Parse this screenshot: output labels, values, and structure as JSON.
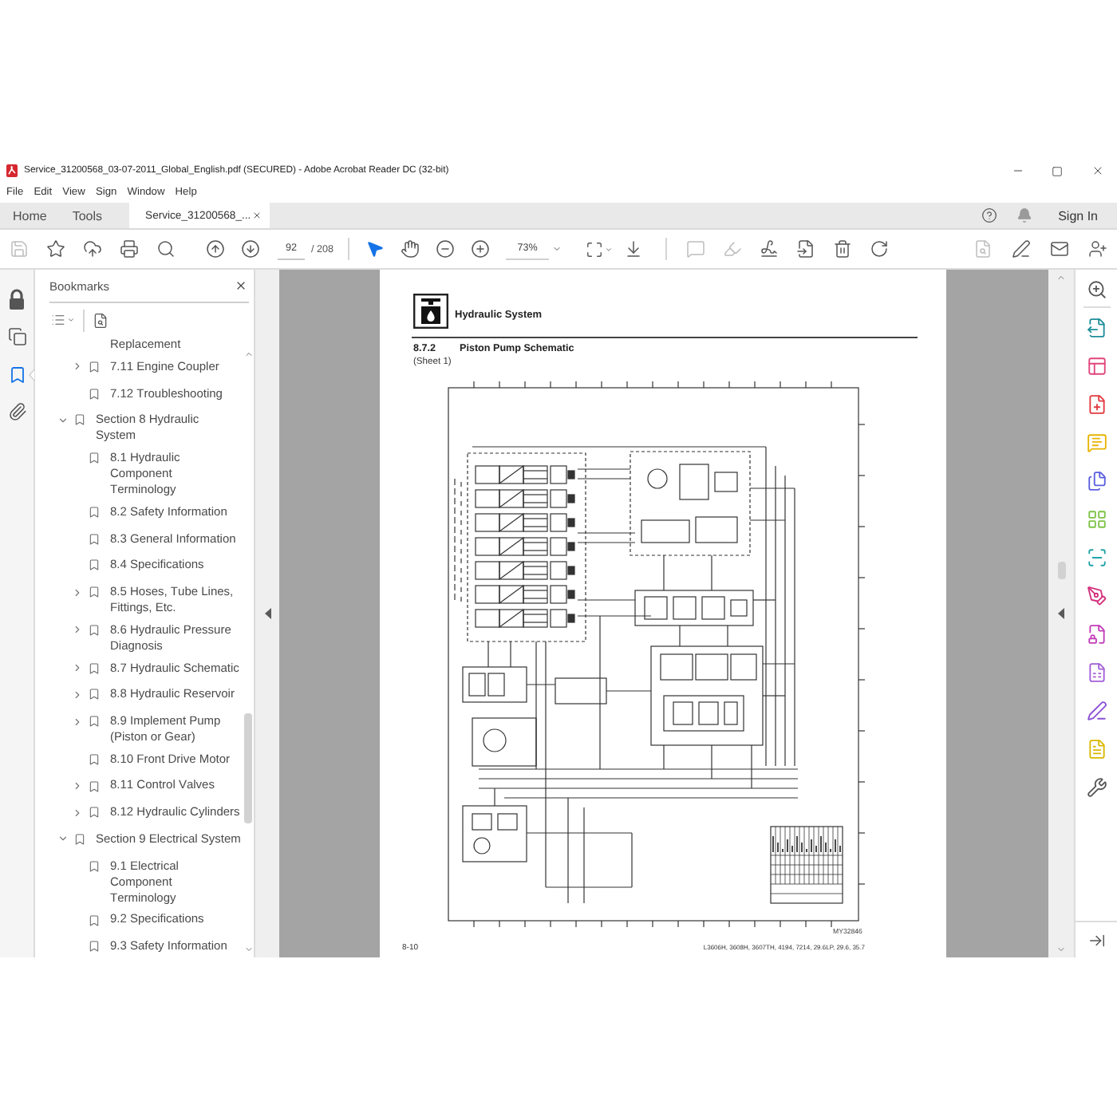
{
  "window": {
    "title": "Service_31200568_03-07-2011_Global_English.pdf (SECURED) - Adobe Acrobat Reader DC (32-bit)"
  },
  "menu": [
    "File",
    "Edit",
    "View",
    "Sign",
    "Window",
    "Help"
  ],
  "tabs": [
    {
      "label": "Home",
      "kind": "nav",
      "selected": false
    },
    {
      "label": "Tools",
      "kind": "nav",
      "selected": false
    },
    {
      "label": "Service_31200568_...",
      "kind": "document",
      "selected": true
    }
  ],
  "account": {
    "sign_in": "Sign In"
  },
  "toolbar": {
    "file_tools": [
      {
        "kind": "save",
        "disabled": true
      },
      {
        "kind": "bookmark",
        "disabled": false
      },
      {
        "kind": "upload",
        "disabled": false
      },
      {
        "kind": "print",
        "disabled": false
      },
      {
        "kind": "find",
        "disabled": false
      }
    ],
    "page_number": "92",
    "page_count": "/ 208",
    "pointer_tools": [
      {
        "kind": "select",
        "selected": true
      },
      {
        "kind": "hand",
        "selected": false
      }
    ],
    "zoom": "73%",
    "edit_tools": [
      {
        "kind": "comment",
        "disabled": true
      },
      {
        "kind": "highlight",
        "disabled": true
      },
      {
        "kind": "sign",
        "disabled": false
      },
      {
        "kind": "page",
        "disabled": false
      },
      {
        "kind": "delete",
        "disabled": false
      },
      {
        "kind": "rotate",
        "disabled": false
      }
    ],
    "share_tools": [
      {
        "kind": "file",
        "disabled": true
      },
      {
        "kind": "draw",
        "disabled": false
      },
      {
        "kind": "mail",
        "disabled": false
      },
      {
        "kind": "account",
        "disabled": false
      }
    ]
  },
  "nav_rail": [
    {
      "kind": "security",
      "selected": false
    },
    {
      "kind": "pages",
      "selected": false
    },
    {
      "kind": "bookmarks",
      "selected": true
    },
    {
      "kind": "attachments",
      "selected": false
    }
  ],
  "bookmarks": {
    "title": "Bookmarks",
    "continued": [
      {
        "label": "Replacement",
        "kind": "continuation"
      },
      {
        "label": "7.11 Engine Coupler",
        "kind": "branch",
        "expanded": false
      },
      {
        "label": "7.12 Troubleshooting",
        "kind": "leaf"
      }
    ],
    "items": [
      {
        "label": "Section 8 Hydraulic System",
        "kind": "branch",
        "expanded": true,
        "children": [
          {
            "label": "8.1 Hydraulic Component Terminology",
            "kind": "leaf"
          },
          {
            "label": "8.2 Safety Information",
            "kind": "leaf"
          },
          {
            "label": "8.3 General Information",
            "kind": "leaf"
          },
          {
            "label": "8.4 Specifications",
            "kind": "leaf"
          },
          {
            "label": "8.5 Hoses, Tube Lines, Fittings, Etc.",
            "kind": "branch",
            "expanded": false
          },
          {
            "label": "8.6 Hydraulic Pressure Diagnosis",
            "kind": "branch",
            "expanded": false
          },
          {
            "label": "8.7 Hydraulic Schematic",
            "kind": "branch",
            "expanded": false
          },
          {
            "label": "8.8 Hydraulic Reservoir",
            "kind": "branch",
            "expanded": false
          },
          {
            "label": "8.9 Implement Pump (Piston or Gear)",
            "kind": "branch",
            "expanded": false
          },
          {
            "label": "8.10 Front Drive Motor",
            "kind": "leaf"
          },
          {
            "label": "8.11 Control Valves",
            "kind": "branch",
            "expanded": false
          },
          {
            "label": "8.12 Hydraulic Cylinders",
            "kind": "branch",
            "expanded": false
          }
        ]
      },
      {
        "label": "Section 9 Electrical System",
        "kind": "branch",
        "expanded": true,
        "children": [
          {
            "label": "9.1 Electrical Component Terminology",
            "kind": "leaf"
          },
          {
            "label": "9.2 Specifications",
            "kind": "leaf"
          },
          {
            "label": "9.3 Safety Information",
            "kind": "leaf"
          }
        ]
      }
    ]
  },
  "document": {
    "header": "Hydraulic System",
    "section_number": "8.7.2",
    "section_title": "Piston Pump Schematic",
    "sheet": "(Sheet 1)",
    "figure_code": "MY32846",
    "page_label": "8-10",
    "applicability": "L3606H, 3608H, 3607TH, 4194, 7214, 29.6LP, 29.6, 35.7"
  },
  "tools_pane": [
    {
      "kind": "zoom",
      "color": "#555555"
    },
    {
      "kind": "export",
      "color": "#1d8d9a"
    },
    {
      "kind": "edit",
      "color": "#e0457b"
    },
    {
      "kind": "create",
      "color": "#e2393f"
    },
    {
      "kind": "comment",
      "color": "#e8b400"
    },
    {
      "kind": "combine",
      "color": "#5b5fe0"
    },
    {
      "kind": "organize",
      "color": "#7cc244"
    },
    {
      "kind": "scan",
      "color": "#1fa3a8"
    },
    {
      "kind": "fill_sign",
      "color": "#d4307d"
    },
    {
      "kind": "protect",
      "color": "#c23bb8"
    },
    {
      "kind": "form",
      "color": "#a35dd6"
    },
    {
      "kind": "sign",
      "color": "#8a4fd6"
    },
    {
      "kind": "send",
      "color": "#d9b800"
    },
    {
      "kind": "more",
      "color": "#555555"
    }
  ]
}
